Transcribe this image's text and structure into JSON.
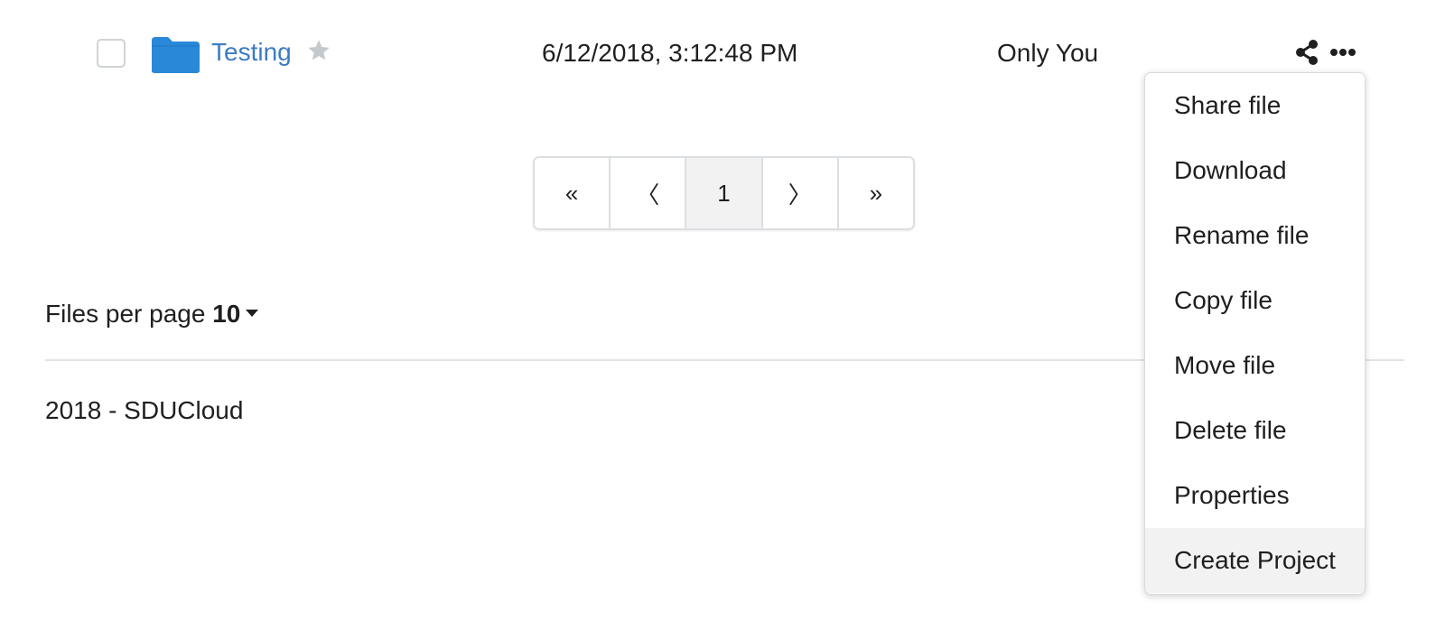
{
  "file_row": {
    "name": "Testing",
    "modified": "6/12/2018, 3:12:48 PM",
    "access": "Only You",
    "folder_color": "#2a88d8",
    "name_color": "#3d7cc4",
    "icons": {
      "folder": "folder-icon",
      "star": "star-icon",
      "share": "share-icon",
      "more": "more-options-icon"
    }
  },
  "pagination": {
    "first": "«",
    "prev": "〈",
    "current": "1",
    "next": "〉",
    "last": "»"
  },
  "per_page": {
    "label": "Files per page",
    "value": "10"
  },
  "footer": {
    "text": "2018 - SDUCloud"
  },
  "menu": {
    "items": [
      {
        "label": "Share file"
      },
      {
        "label": "Download"
      },
      {
        "label": "Rename file"
      },
      {
        "label": "Copy file"
      },
      {
        "label": "Move file"
      },
      {
        "label": "Delete file"
      },
      {
        "label": "Properties"
      },
      {
        "label": "Create Project"
      }
    ],
    "highlighted": "Create Project"
  }
}
